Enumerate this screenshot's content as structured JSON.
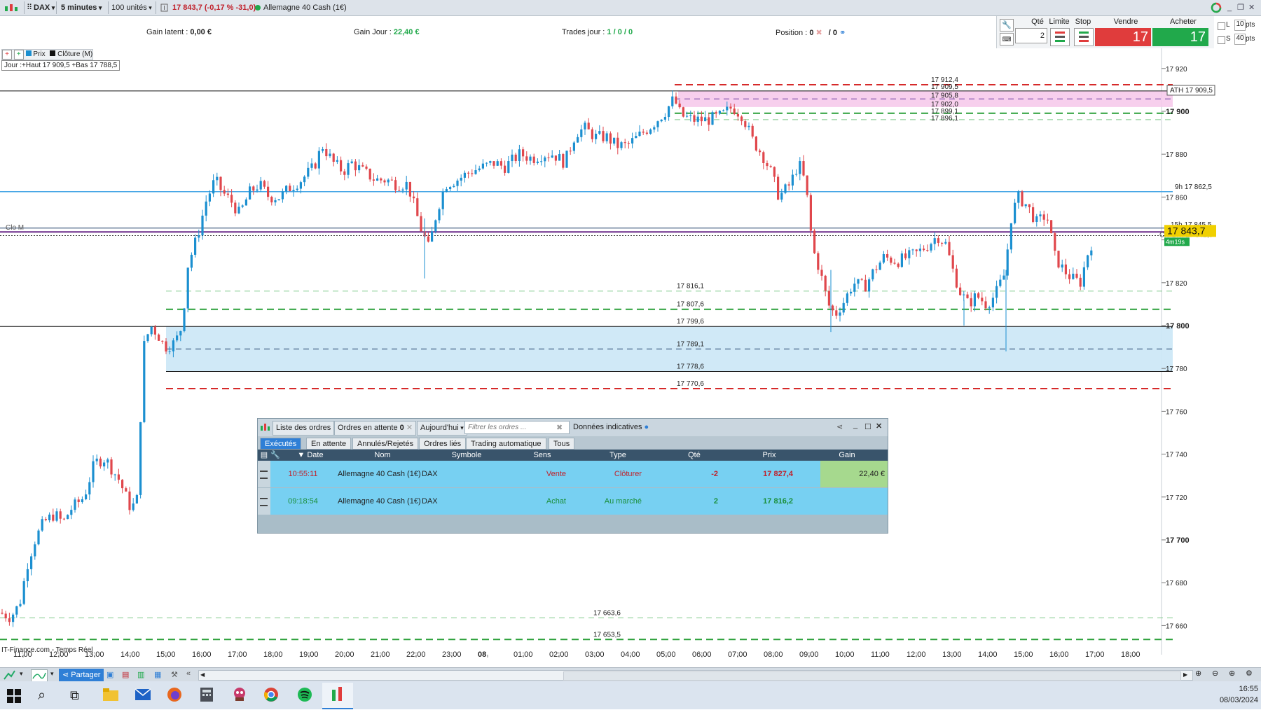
{
  "topbar": {
    "instrument": "DAX",
    "timeframe": "5 minutes",
    "units": "100 unités",
    "quote": "17 843,7 (-0,17 % -31,0)",
    "market": "Allemagne 40 Cash (1€)"
  },
  "infobar": {
    "gain_latent_label": "Gain latent :",
    "gain_latent_value": "0,00 €",
    "gain_jour_label": "Gain Jour :",
    "gain_jour_value": "22,40 €",
    "trades_label": "Trades jour :",
    "trades_value": "1 / 0 / 0",
    "position_label": "Position :",
    "position_value": "0",
    "position_value2": "/ 0"
  },
  "tradepanel": {
    "qty_label": "Qté",
    "qty_value": "2",
    "limit_label": "Limite",
    "stop_label": "Stop",
    "sell_label": "Vendre",
    "buy_label": "Acheter",
    "sell_price": "17 843,0",
    "buy_price": "17 844,4",
    "l_label": "L",
    "l_pts": "10",
    "s_label": "S",
    "s_pts": "40",
    "pts": "pts"
  },
  "chart_toolbar": {
    "prix": "Prix",
    "cloture": "Clôture (M)",
    "jour": "Jour :+Haut 17 909,5 +Bas 17 788,5"
  },
  "chart_data": {
    "type": "candlestick",
    "instrument": "Allemagne 40 Cash (1€)",
    "timeframe": "5 minutes",
    "y_ticks": [
      17920,
      17900,
      17880,
      17860,
      17840,
      17820,
      17800,
      17780,
      17760,
      17740,
      17720,
      17700,
      17680,
      17660
    ],
    "y_tick_labels": [
      "17 920",
      "17 900",
      "17 880",
      "17 860",
      "17 840",
      "17 820",
      "17 800",
      "17 780",
      "17 760",
      "17 740",
      "17 720",
      "17 700",
      "17 680",
      "17 660"
    ],
    "x_ticks": [
      "11:00",
      "12:00",
      "13:00",
      "14:00",
      "15:00",
      "16:00",
      "17:00",
      "18:00",
      "19:00",
      "20:00",
      "21:00",
      "22:00",
      "23:00",
      "08",
      "01:00",
      "02:00",
      "03:00",
      "04:00",
      "05:00",
      "06:00",
      "07:00",
      "08:00",
      "09:00",
      "10:00",
      "11:00",
      "12:00",
      "13:00",
      "14:00",
      "15:00",
      "16:00",
      "17:00",
      "18:00",
      "19:00",
      "20:00"
    ],
    "last_price": "17 843,7",
    "countdown": "4m19s",
    "last_price_small": "17 843,7",
    "levels": [
      {
        "label": "17 912,4",
        "value": 17912.4
      },
      {
        "label": "17 909,5",
        "value": 17909.5
      },
      {
        "label": "17 905,8",
        "value": 17905.8
      },
      {
        "label": "17 902,0",
        "value": 17902.0
      },
      {
        "label": "17 899,1",
        "value": 17899.1
      },
      {
        "label": "17 896,1",
        "value": 17896.1
      },
      {
        "label": "17 816,1",
        "value": 17816.1
      },
      {
        "label": "17 807,6",
        "value": 17807.6
      },
      {
        "label": "17 799,6",
        "value": 17799.6
      },
      {
        "label": "17 789,1",
        "value": 17789.1
      },
      {
        "label": "17 778,6",
        "value": 17778.6
      },
      {
        "label": "17 770,6",
        "value": 17770.6
      },
      {
        "label": "17 663,6",
        "value": 17663.6
      },
      {
        "label": "17 653,5",
        "value": 17653.5
      }
    ],
    "annotations": {
      "ath": "ATH 17 909,5",
      "h9": "9h 17 862,5",
      "h15": "15h 17 845,5",
      "clo": "Clo 17h 17 842,0",
      "clo_m": "Clo M"
    },
    "source": "IT-Finance.com - Temps Réel"
  },
  "orders": {
    "title_tab1": "Liste des ordres",
    "title_tab2": "Ordres en attente",
    "title_tab2_count": "0",
    "period": "Aujourd'hui",
    "filter_placeholder": "Filtrer les ordres ...",
    "indicative": "Données indicatives",
    "tabs": [
      "Exécutés",
      "En attente",
      "Annulés/Rejetés",
      "Ordres liés",
      "Trading automatique",
      "Tous"
    ],
    "columns": [
      "Date",
      "Nom",
      "Symbole",
      "Sens",
      "Type",
      "Qté",
      "Prix",
      "Gain"
    ],
    "rows": [
      {
        "date": "10:55:11",
        "nom": "Allemagne 40 Cash (1€)",
        "symbole": "DAX",
        "sens": "Vente",
        "type": "Clôturer",
        "qte": "-2",
        "prix": "17 827,4",
        "gain": "22,40 €"
      },
      {
        "date": "09:18:54",
        "nom": "Allemagne 40 Cash (1€)",
        "symbole": "DAX",
        "sens": "Achat",
        "type": "Au marché",
        "qte": "2",
        "prix": "17 816,2",
        "gain": ""
      }
    ]
  },
  "bottombar": {
    "share": "Partager"
  },
  "taskbar": {
    "time": "16:55",
    "date": "08/03/2024"
  },
  "colors": {
    "up": "#1b8fd0",
    "down": "#e0474c",
    "sell": "#e03c3c",
    "buy": "#21a94b",
    "zone_pink": "#f6c7ea",
    "zone_blue": "#cde8f7"
  }
}
